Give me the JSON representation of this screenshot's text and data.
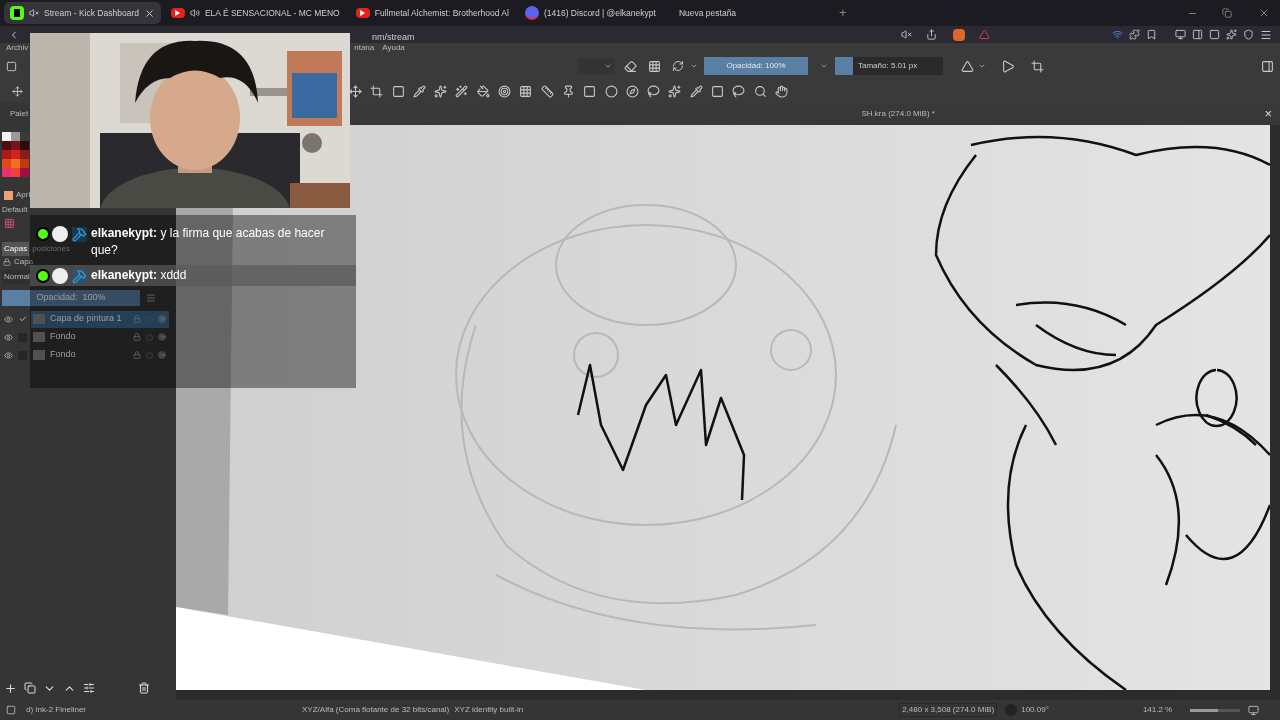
{
  "browser": {
    "tabs": [
      {
        "title": "Stream - Kick Dashboard",
        "kind": "kick",
        "selected": true
      },
      {
        "title": "ELA É SENSACIONAL - MC MENO",
        "kind": "youtube",
        "selected": false
      },
      {
        "title": "Fullmetal Alchemist: Brotherhood Al",
        "kind": "youtube",
        "selected": false
      },
      {
        "title": "(1416) Discord | @elkanekypt",
        "kind": "discord",
        "selected": false
      },
      {
        "title": "Nueva pestaña",
        "kind": "blank",
        "selected": false
      }
    ],
    "new_tab": "+",
    "address": "nm/stream"
  },
  "menu": [
    "Archiv",
    "ntana",
    "Ayuda"
  ],
  "toolbar": {
    "opacity": {
      "label": "Opacidad: 100%",
      "level": 1
    },
    "size": {
      "label": "Tamaño: 5.01 px"
    }
  },
  "document": {
    "title": "SH.kra (274.0 MiB) *",
    "close": "×"
  },
  "dockers": {
    "palette_title": "Palet",
    "palette": [
      {
        "color": "#f2f2f2"
      },
      {
        "color": "#9a9a9a"
      },
      {
        "color": "#3a3a3a"
      },
      {
        "color": "#4a1010"
      },
      {
        "color": "#7a1414"
      },
      {
        "color": "#2a0a0a"
      },
      {
        "color": "#b01818"
      },
      {
        "color": "#d42020"
      },
      {
        "color": "#8a1c1c"
      },
      {
        "color": "#e04a1a"
      },
      {
        "color": "#f07020"
      },
      {
        "color": "#c03a10"
      },
      {
        "color": "#e8306a"
      },
      {
        "color": "#f04040"
      },
      {
        "color": "#a01040"
      }
    ],
    "resource": "Apri",
    "preset_set": "Default",
    "tabs": [
      {
        "label": "Capas",
        "selected": true
      },
      {
        "label": "posiciones",
        "selected": false
      }
    ],
    "layers_title": "Capa",
    "blend_mode": "Normal",
    "opacity": {
      "label": "Opacidad:  100%",
      "level": 1
    },
    "layers": [
      {
        "name": "Capa de pintura 1",
        "selected": true,
        "visible": true,
        "checked": true
      },
      {
        "name": "Fondo",
        "selected": false,
        "visible": true,
        "checked": false
      },
      {
        "name": "Fondo",
        "selected": false,
        "visible": true,
        "checked": false
      }
    ]
  },
  "chat": [
    {
      "user": "elkanekypt:",
      "text": "y la firma que acabas de hacer que?",
      "highlighted": false
    },
    {
      "user": "elkanekypt:",
      "text": "xddd",
      "highlighted": true
    }
  ],
  "status_bar": {
    "brush": "d) Ink-2 Fineliner",
    "color_space": "XYZ/Alfa (Coma flotante de 32 bits/canal)",
    "profile": "XYZ identity built-in",
    "size": "2,480 x 3,508 (274.0 MiB)",
    "rotation": "100.09°",
    "zoom": "141.2 %",
    "zoom_slider": {
      "level": 0.55
    }
  }
}
